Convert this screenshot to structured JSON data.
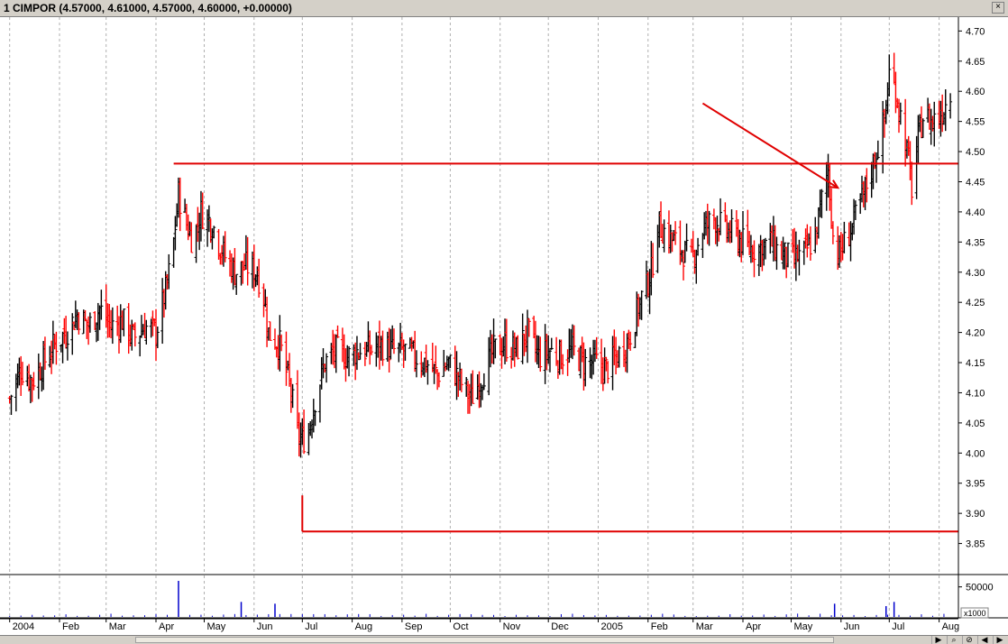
{
  "window": {
    "title": "1 CIMPOR (4.57000, 4.61000, 4.57000, 4.60000, +0.00000)",
    "close_label": "×"
  },
  "nav_buttons": [
    "▶",
    "⌕",
    "⊘",
    "◀",
    "▶"
  ],
  "colors": {
    "up": "#000000",
    "down": "#ff0000",
    "annotation": "#e00000",
    "volume": "#0000cc",
    "grid": "#b0b0b0"
  },
  "chart_data": {
    "type": "bar",
    "subtype": "ohlc",
    "title": "1 CIMPOR (4.57000, 4.61000, 4.57000, 4.60000, +0.00000)",
    "y_ticks": [
      "4.70",
      "4.65",
      "4.60",
      "4.55",
      "4.50",
      "4.45",
      "4.40",
      "4.35",
      "4.30",
      "4.25",
      "4.20",
      "4.15",
      "4.10",
      "4.05",
      "4.00",
      "3.95",
      "3.90",
      "3.85"
    ],
    "ylim": [
      3.8,
      4.72
    ],
    "x_ticks": [
      "2004",
      "Feb",
      "Mar",
      "Apr",
      "May",
      "Jun",
      "Jul",
      "Aug",
      "Sep",
      "Oct",
      "Nov",
      "Dec",
      "2005",
      "Feb",
      "Mar",
      "Apr",
      "May",
      "Jun",
      "Jul",
      "Aug"
    ],
    "grid": "vertical dashed at month boundaries",
    "series": [
      {
        "segments": [
          [
            "2004-01-01",
            4.09
          ],
          [
            "2004-01-08",
            4.14
          ],
          [
            "2004-01-15",
            4.12
          ],
          [
            "2004-01-22",
            4.15
          ],
          [
            "2004-01-29",
            4.18
          ],
          [
            "2004-02-05",
            4.2
          ],
          [
            "2004-02-12",
            4.23
          ],
          [
            "2004-02-19",
            4.21
          ],
          [
            "2004-02-26",
            4.24
          ],
          [
            "2004-03-04",
            4.21
          ],
          [
            "2004-03-11",
            4.22
          ],
          [
            "2004-03-18",
            4.19
          ],
          [
            "2004-03-25",
            4.21
          ],
          [
            "2004-04-01",
            4.2
          ],
          [
            "2004-04-08",
            4.28
          ],
          [
            "2004-04-12",
            4.35
          ],
          [
            "2004-04-15",
            4.43
          ],
          [
            "2004-04-20",
            4.38
          ],
          [
            "2004-04-24",
            4.35
          ],
          [
            "2004-04-29",
            4.4
          ],
          [
            "2004-05-06",
            4.38
          ],
          [
            "2004-05-13",
            4.33
          ],
          [
            "2004-05-20",
            4.3
          ],
          [
            "2004-05-27",
            4.31
          ],
          [
            "2004-06-03",
            4.3
          ],
          [
            "2004-06-07",
            4.26
          ],
          [
            "2004-06-10",
            4.2
          ],
          [
            "2004-06-17",
            4.18
          ],
          [
            "2004-06-24",
            4.1
          ],
          [
            "2004-06-28",
            4.03
          ],
          [
            "2004-07-01",
            4.02
          ],
          [
            "2004-07-05",
            4.04
          ],
          [
            "2004-07-09",
            4.09
          ],
          [
            "2004-07-15",
            4.15
          ],
          [
            "2004-07-22",
            4.17
          ],
          [
            "2004-07-29",
            4.16
          ],
          [
            "2004-08-05",
            4.17
          ],
          [
            "2004-08-12",
            4.17
          ],
          [
            "2004-08-19",
            4.18
          ],
          [
            "2004-08-26",
            4.17
          ],
          [
            "2004-09-02",
            4.17
          ],
          [
            "2004-09-09",
            4.16
          ],
          [
            "2004-09-16",
            4.15
          ],
          [
            "2004-09-23",
            4.13
          ],
          [
            "2004-09-30",
            4.15
          ],
          [
            "2004-10-07",
            4.12
          ],
          [
            "2004-10-14",
            4.09
          ],
          [
            "2004-10-21",
            4.13
          ],
          [
            "2004-10-28",
            4.17
          ],
          [
            "2004-11-04",
            4.18
          ],
          [
            "2004-11-11",
            4.17
          ],
          [
            "2004-11-18",
            4.2
          ],
          [
            "2004-11-25",
            4.16
          ],
          [
            "2004-12-02",
            4.17
          ],
          [
            "2004-12-09",
            4.16
          ],
          [
            "2004-12-16",
            4.17
          ],
          [
            "2004-12-23",
            4.15
          ],
          [
            "2004-12-30",
            4.15
          ],
          [
            "2005-01-06",
            4.14
          ],
          [
            "2005-01-13",
            4.16
          ],
          [
            "2005-01-20",
            4.19
          ],
          [
            "2005-01-27",
            4.25
          ],
          [
            "2005-02-03",
            4.3
          ],
          [
            "2005-02-07",
            4.38
          ],
          [
            "2005-02-14",
            4.36
          ],
          [
            "2005-02-21",
            4.34
          ],
          [
            "2005-02-28",
            4.32
          ],
          [
            "2005-03-07",
            4.37
          ],
          [
            "2005-03-14",
            4.39
          ],
          [
            "2005-03-21",
            4.37
          ],
          [
            "2005-03-28",
            4.36
          ],
          [
            "2005-04-04",
            4.34
          ],
          [
            "2005-04-11",
            4.34
          ],
          [
            "2005-04-18",
            4.35
          ],
          [
            "2005-04-25",
            4.33
          ],
          [
            "2005-05-02",
            4.32
          ],
          [
            "2005-05-09",
            4.33
          ],
          [
            "2005-05-16",
            4.36
          ],
          [
            "2005-05-20",
            4.42
          ],
          [
            "2005-05-24",
            4.47
          ],
          [
            "2005-05-27",
            4.36
          ],
          [
            "2005-05-31",
            4.33
          ],
          [
            "2005-06-07",
            4.37
          ],
          [
            "2005-06-14",
            4.42
          ],
          [
            "2005-06-21",
            4.48
          ],
          [
            "2005-06-28",
            4.55
          ],
          [
            "2005-07-01",
            4.63
          ],
          [
            "2005-07-05",
            4.6
          ],
          [
            "2005-07-08",
            4.56
          ],
          [
            "2005-07-12",
            4.5
          ],
          [
            "2005-07-15",
            4.44
          ],
          [
            "2005-07-19",
            4.52
          ],
          [
            "2005-07-22",
            4.56
          ],
          [
            "2005-07-27",
            4.55
          ],
          [
            "2005-08-01",
            4.56
          ],
          [
            "2005-08-05",
            4.58
          ],
          [
            "2005-08-08",
            4.6
          ]
        ]
      }
    ],
    "volume": {
      "y_ticks": [
        "50000"
      ],
      "multiplier_label": "x1000",
      "spikes": [
        [
          "2004-04-15",
          60000
        ],
        [
          "2004-05-24",
          25000
        ],
        [
          "2004-06-14",
          22000
        ],
        [
          "2005-05-28",
          22000
        ],
        [
          "2005-06-29",
          18000
        ],
        [
          "2005-07-04",
          25000
        ]
      ]
    },
    "annotations": [
      {
        "kind": "horizontal-line",
        "y": 4.48,
        "from": "2004-04-12",
        "to": "end"
      },
      {
        "kind": "horizontal-line",
        "y": 3.87,
        "from": "2004-07-01",
        "to": "end"
      },
      {
        "kind": "arrow",
        "from": [
          "2005-03-07",
          4.58
        ],
        "to": [
          "2005-05-30",
          4.44
        ]
      }
    ]
  }
}
